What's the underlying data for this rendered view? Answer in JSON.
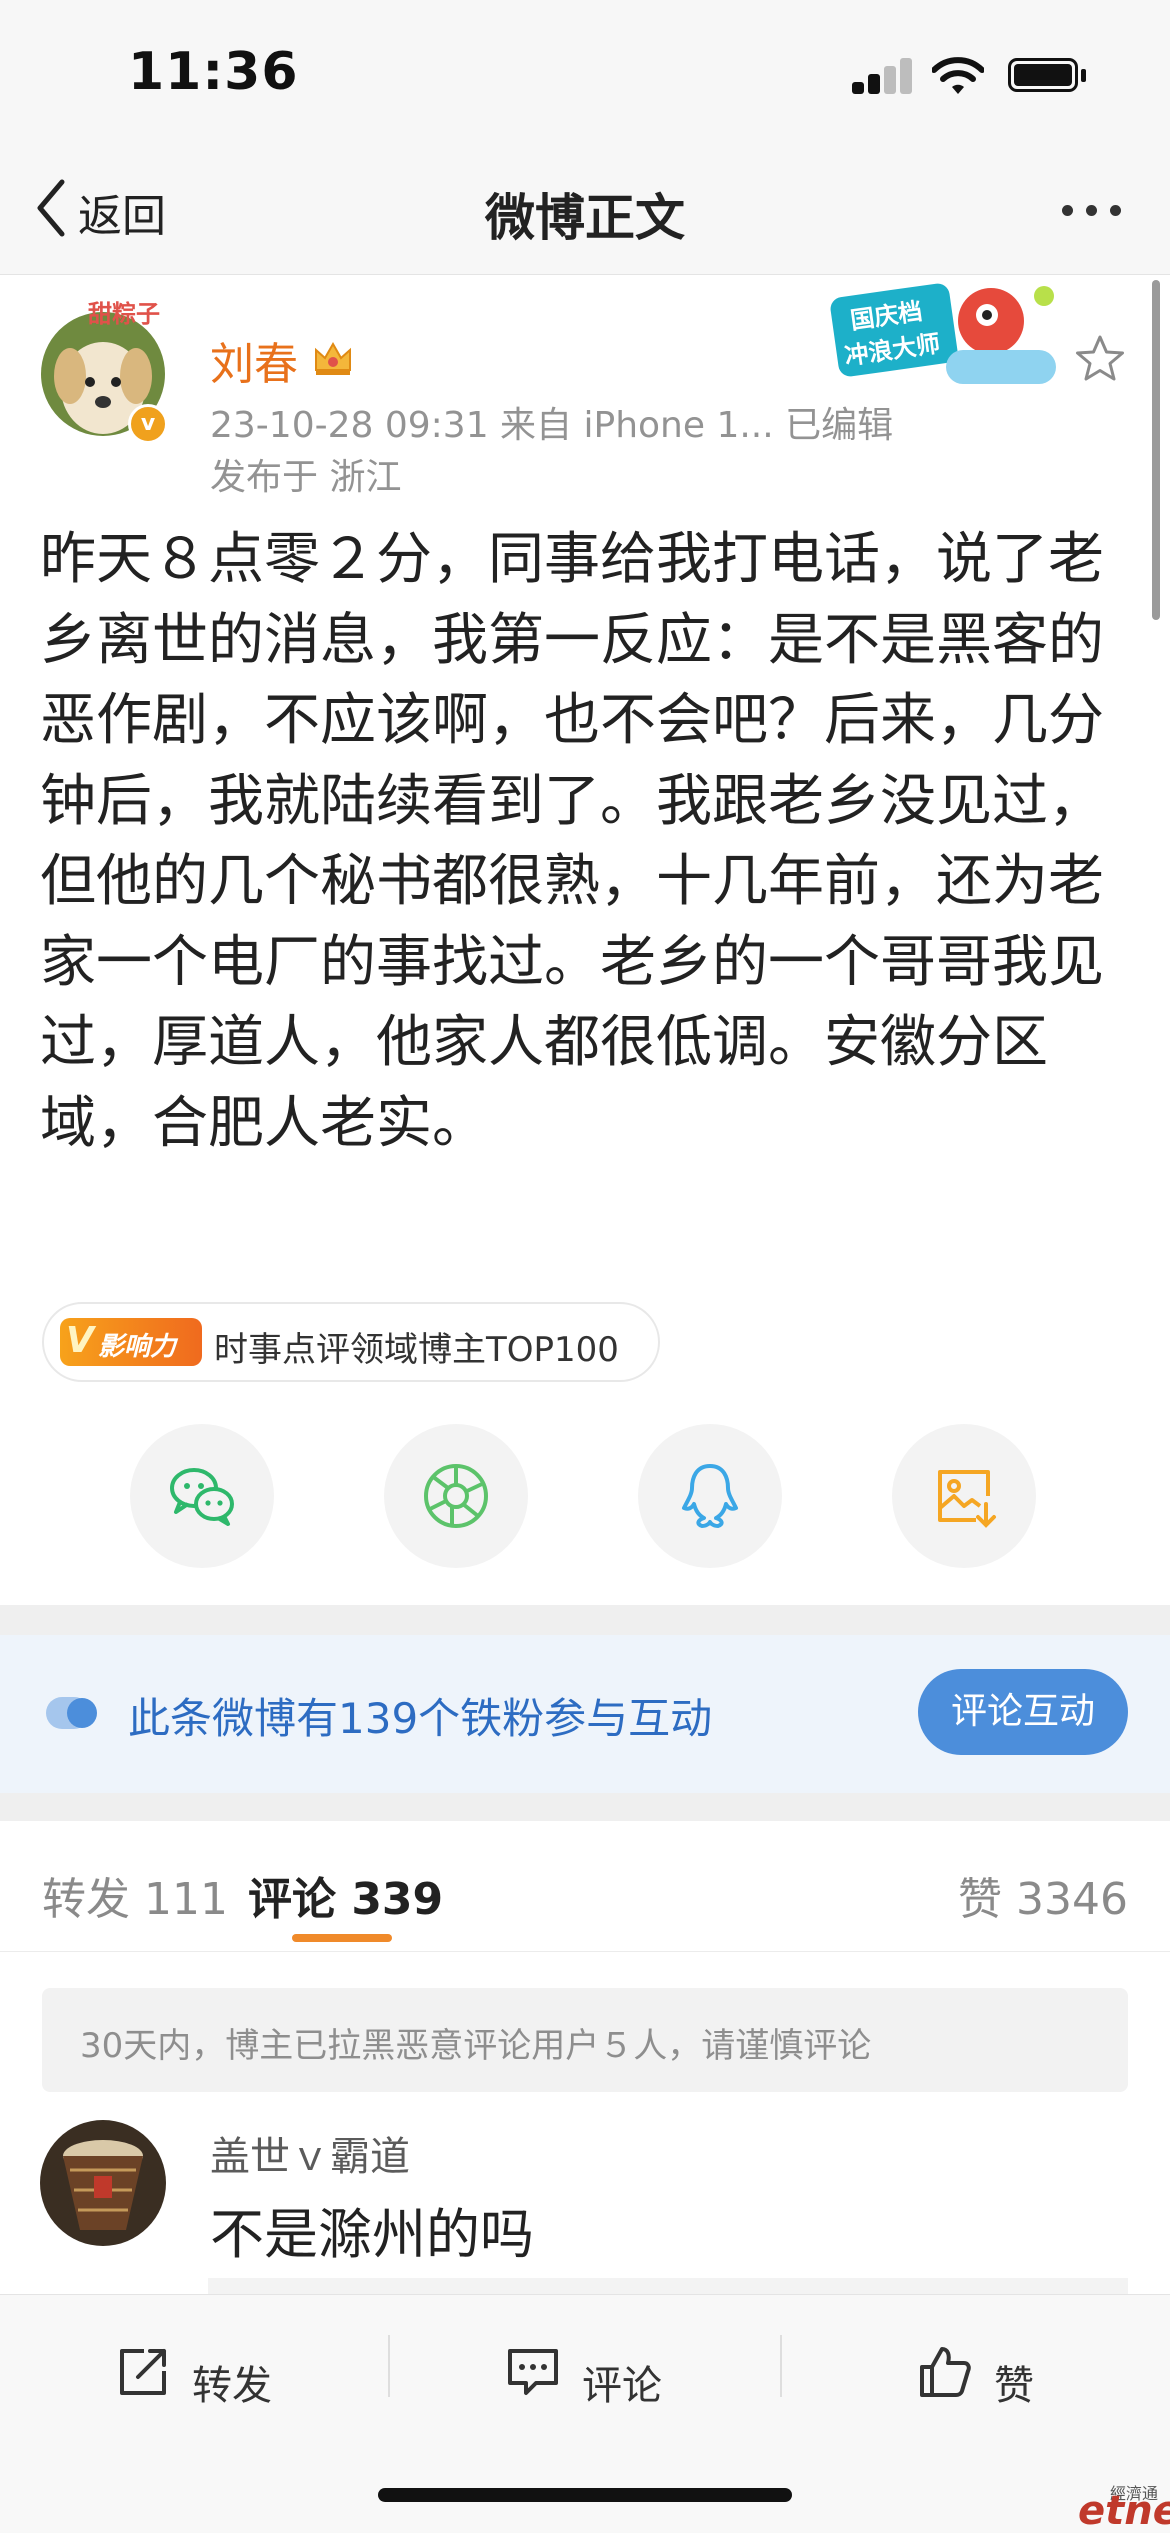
{
  "status_bar": {
    "time": "11:36"
  },
  "nav": {
    "back_label": "返回",
    "title": "微博正文"
  },
  "post": {
    "author": "刘春",
    "meta": "23-10-28 09:31  来自 iPhone 1...  已编辑",
    "location": "发布于 浙江",
    "avatar_caption": "甜粽子",
    "promo_badge_line1": "国庆档",
    "promo_badge_line2": "冲浪大师",
    "text": "昨天８点零２分，同事给我打电话，说了老乡离世的消息，我第一反应：是不是黑客的恶作剧，不应该啊，也不会吧？后来，几分钟后，我就陆续看到了。我跟老乡没见过，但他的几个秘书都很熟，十几年前，还为老家一个电厂的事找过。老乡的一个哥哥我见过，厚道人，他家人都很低调。安徽分区域，合肥人老实。",
    "influence_icon_text": "影响力",
    "influence_badge": "时事点评领域博主TOP100"
  },
  "share_icons": [
    "wechat-icon",
    "moments-icon",
    "qq-icon",
    "save-image-icon"
  ],
  "fans_banner": {
    "text": "此条微博有139个铁粉参与互动",
    "button": "评论互动"
  },
  "tabs": {
    "repost": "转发 111",
    "comment": "评论 339",
    "like": "赞 3346"
  },
  "notice": "30天内，博主已拉黑恶意评论用户５人，请谨慎评论",
  "comment": {
    "user": "盖世ｖ霸道",
    "text": "不是滁州的吗"
  },
  "bottom_bar": {
    "repost": "转发",
    "comment": "评论",
    "like": "赞"
  },
  "watermark": {
    "main": "etnet",
    "small": "經濟通"
  },
  "colors": {
    "accent": "#f08a2a",
    "link_blue": "#2d6cc2",
    "button_blue": "#4c8edb",
    "author_orange": "#e8711b"
  }
}
